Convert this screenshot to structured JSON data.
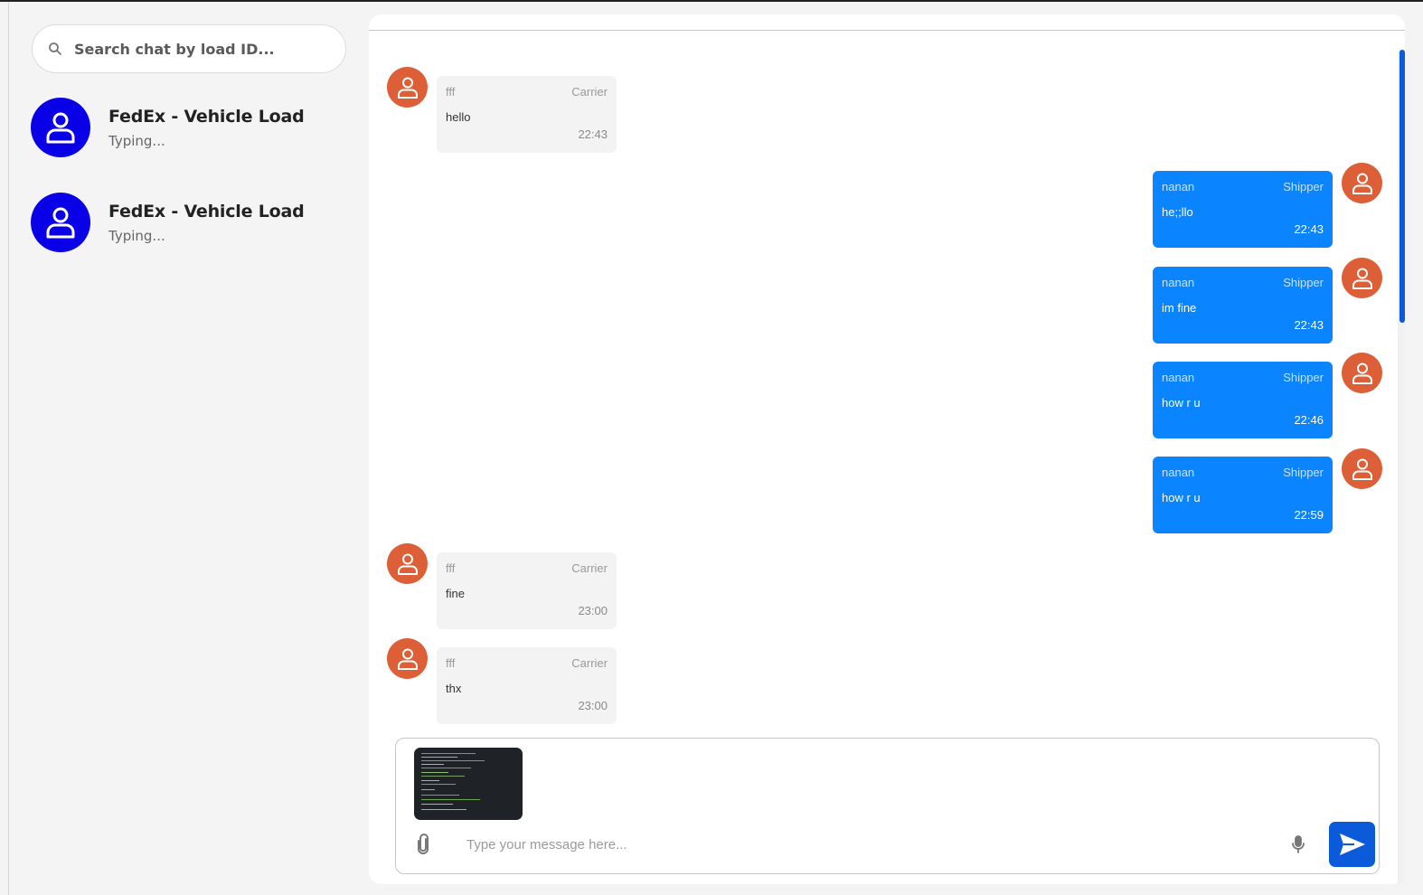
{
  "search": {
    "placeholder": "Search chat by load ID..."
  },
  "sidebar": {
    "chats": [
      {
        "title": "FedEx - Vehicle Load",
        "status": "Typing..."
      },
      {
        "title": "FedEx - Vehicle Load",
        "status": "Typing..."
      }
    ]
  },
  "messages": [
    {
      "sender": "fff",
      "role": "Carrier",
      "text": "hello",
      "time": "22:43",
      "direction": "incoming"
    },
    {
      "sender": "nanan",
      "role": "Shipper",
      "text": "he;;llo",
      "time": "22:43",
      "direction": "outgoing"
    },
    {
      "sender": "nanan",
      "role": "Shipper",
      "text": "im fine",
      "time": "22:43",
      "direction": "outgoing"
    },
    {
      "sender": "nanan",
      "role": "Shipper",
      "text": "how r u",
      "time": "22:46",
      "direction": "outgoing"
    },
    {
      "sender": "nanan",
      "role": "Shipper",
      "text": "how r u",
      "time": "22:59",
      "direction": "outgoing"
    },
    {
      "sender": "fff",
      "role": "Carrier",
      "text": "fine",
      "time": "23:00",
      "direction": "incoming"
    },
    {
      "sender": "fff",
      "role": "Carrier",
      "text": "thx",
      "time": "23:00",
      "direction": "incoming"
    }
  ],
  "composer": {
    "placeholder": "Type your message here...",
    "attachment_icon": "paperclip-icon",
    "mic_icon": "microphone-icon",
    "send_icon": "send-icon"
  },
  "colors": {
    "sidebar_avatar": "#0a00e8",
    "message_avatar": "#dd5f37",
    "outgoing_bubble": "#0a84ff",
    "incoming_bubble": "#f3f3f3",
    "send_button": "#0b5ad9"
  }
}
